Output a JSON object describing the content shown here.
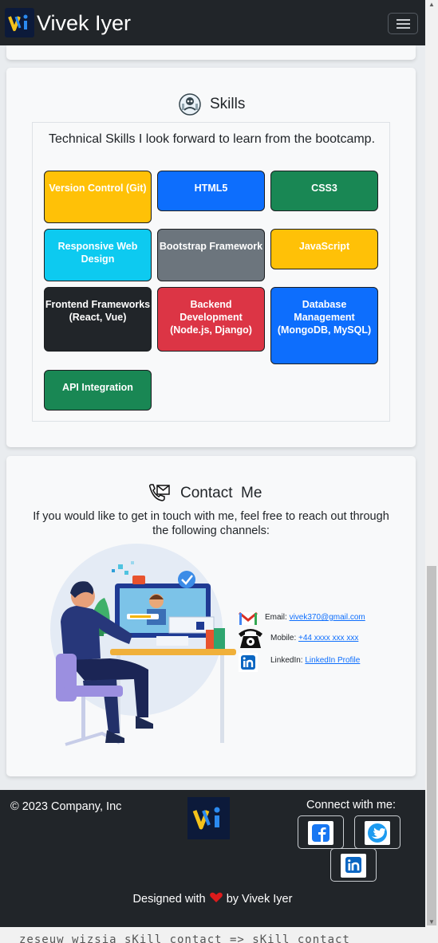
{
  "nav": {
    "brand": "Vivek Iyer",
    "logo_text": "Vi"
  },
  "skills": {
    "title": "Skills",
    "intro": "Technical Skills I look forward to learn from the bootcamp.",
    "items": [
      {
        "label": "Version Control (Git)",
        "color": "#ffc107",
        "text_color": "#ffffff"
      },
      {
        "label": "HTML5",
        "color": "#0d6efd",
        "text_color": "#ffffff"
      },
      {
        "label": "CSS3",
        "color": "#198754",
        "text_color": "#ffffff"
      },
      {
        "label": "Responsive Web Design",
        "color": "#0dcaf0",
        "text_color": "#ffffff"
      },
      {
        "label": "Bootstrap Framework",
        "color": "#6c757d",
        "text_color": "#ffffff"
      },
      {
        "label": "JavaScript",
        "color": "#ffc107",
        "text_color": "#ffffff"
      },
      {
        "label": "Frontend Frameworks (React, Vue)",
        "color": "#212529",
        "text_color": "#ffffff"
      },
      {
        "label": "Backend Development (Node.js, Django)",
        "color": "#dc3545",
        "text_color": "#ffffff"
      },
      {
        "label": "Database Management (MongoDB, MySQL)",
        "color": "#0d6efd",
        "text_color": "#ffffff"
      },
      {
        "label": "API Integration",
        "color": "#198754",
        "text_color": "#ffffff"
      }
    ]
  },
  "contact": {
    "title_part1": "Contact",
    "title_part2": "Me",
    "text": "If you would like to get in touch with me, feel free to reach out through the following channels:",
    "email_label": "Email:",
    "email_value": "vivek370@gmail.com",
    "mobile_label": "Mobile:",
    "mobile_value": "+44 xxxx xxx xxx",
    "linkedin_label": "LinkedIn:",
    "linkedin_value": "LinkedIn Profile"
  },
  "footer": {
    "copyright": "© 2023 Company, Inc",
    "logo_text": "Vi",
    "connect": "Connect with me:",
    "designed_prefix": "Designed with",
    "designed_suffix": "by Vivek Iyer"
  },
  "bottom_strip_text": "zeseuw   wizsia   sKill contact => sKill contact",
  "colors": {
    "navbar": "#212529",
    "card": "#f8f9fa",
    "link": "#0d6efd",
    "heart": "#dc1b1b"
  }
}
